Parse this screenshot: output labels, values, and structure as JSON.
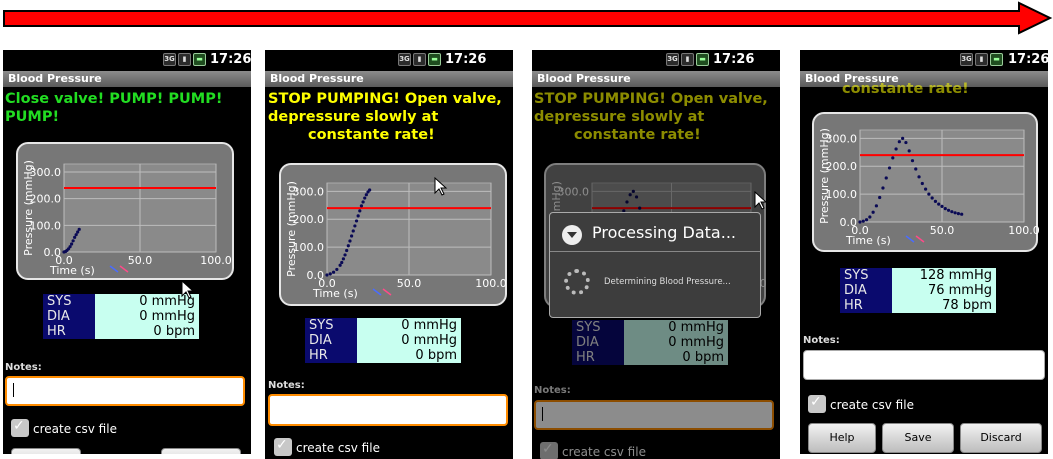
{
  "colors": {
    "instruction_green": "#22dd22",
    "instruction_yellow": "#ffff00",
    "threshold_line": "#ff0000",
    "label_bg": "#0a0a6e",
    "value_bg": "#c8fff0",
    "focus_border": "#ff8c00",
    "arrow": "#ff0000"
  },
  "screens": [
    {
      "status": {
        "time": "17:26"
      },
      "app_title": "Blood Pressure",
      "instruction": "Close valve! PUMP! PUMP! PUMP!",
      "table": [
        {
          "label": "SYS",
          "value": "0 mmHg"
        },
        {
          "label": "DIA",
          "value": "0 mmHg"
        },
        {
          "label": "HR",
          "value": "0 bpm"
        }
      ],
      "notes_label": "Notes:",
      "checkbox_label": "create csv file"
    },
    {
      "status": {
        "time": "17:26"
      },
      "app_title": "Blood Pressure",
      "instruction_l1": "STOP PUMPING! Open valve,",
      "instruction_l2": "depressure slowly at",
      "instruction_l3": "constante rate!",
      "table": [
        {
          "label": "SYS",
          "value": "0 mmHg"
        },
        {
          "label": "DIA",
          "value": "0 mmHg"
        },
        {
          "label": "HR",
          "value": "0 bpm"
        }
      ],
      "notes_label": "Notes:",
      "checkbox_label": "create csv file"
    },
    {
      "status": {
        "time": "17:26"
      },
      "app_title": "Blood Pressure",
      "instruction_l1": "STOP PUMPING! Open valve,",
      "instruction_l2": "depressure slowly at",
      "instruction_l3": "constante rate!",
      "dialog": {
        "title": "Processing Data...",
        "message": "Determining Blood Pressure..."
      },
      "table": [
        {
          "label": "SYS",
          "value": "0 mmHg"
        },
        {
          "label": "DIA",
          "value": "0 mmHg"
        },
        {
          "label": "HR",
          "value": "0 bpm"
        }
      ],
      "notes_label": "Notes:",
      "checkbox_label": "create csv file"
    },
    {
      "status": {
        "time": "17:26"
      },
      "app_title": "Blood Pressure",
      "instruction_partial": "constante rate!",
      "table": [
        {
          "label": "SYS",
          "value": "128 mmHg"
        },
        {
          "label": "DIA",
          "value": "76 mmHg"
        },
        {
          "label": "HR",
          "value": "78 bpm"
        }
      ],
      "notes_label": "Notes:",
      "checkbox_label": "create csv file",
      "buttons": {
        "help": "Help",
        "save": "Save",
        "discard": "Discard"
      }
    }
  ],
  "chart_data": [
    {
      "type": "scatter",
      "ylabel": "Pressure (mmHg)",
      "xlabel": "Time (s)",
      "y_ticks": [
        "0.0",
        "100.0",
        "200.0",
        "300.0"
      ],
      "x_ticks": [
        "0.0",
        "50.0",
        "100.0"
      ],
      "xlim": [
        0,
        100
      ],
      "ylim": [
        0,
        330
      ],
      "threshold": 240,
      "series": [
        {
          "x": [
            0,
            1,
            2,
            3,
            4,
            5,
            6,
            7,
            8,
            9,
            10
          ],
          "y": [
            0,
            2,
            6,
            12,
            20,
            30,
            42,
            55,
            65,
            75,
            85
          ]
        }
      ]
    },
    {
      "type": "scatter",
      "ylabel": "Pressure (mmHg)",
      "xlabel": "Time (s)",
      "y_ticks": [
        "0.0",
        "100.0",
        "200.0",
        "300.0"
      ],
      "x_ticks": [
        "0.0",
        "50.0",
        "100.0"
      ],
      "xlim": [
        0,
        100
      ],
      "ylim": [
        0,
        330
      ],
      "threshold": 240,
      "series": [
        {
          "x": [
            0,
            2,
            4,
            6,
            8,
            9,
            10,
            11,
            12,
            13,
            14,
            15,
            16,
            17,
            18,
            19,
            20,
            21,
            22,
            23,
            24,
            25,
            26
          ],
          "y": [
            0,
            4,
            10,
            20,
            35,
            45,
            58,
            72,
            88,
            105,
            122,
            140,
            158,
            176,
            194,
            212,
            230,
            248,
            262,
            276,
            288,
            298,
            305
          ]
        }
      ]
    },
    {
      "type": "scatter",
      "ylabel": "Pressure (mmHg)",
      "xlabel": "Time (s)",
      "y_ticks": [
        "0.0",
        "100.0",
        "200.0",
        "300.0"
      ],
      "x_ticks": [
        "0.0",
        "50.0",
        "100.0"
      ],
      "xlim": [
        0,
        100
      ],
      "ylim": [
        0,
        330
      ],
      "threshold": 240,
      "series": [
        {
          "x": [
            0,
            4,
            8,
            10,
            12,
            14,
            16,
            18,
            20,
            22,
            24,
            26,
            28,
            30,
            33,
            36,
            40,
            44,
            48,
            52,
            56,
            60
          ],
          "y": [
            0,
            10,
            35,
            58,
            88,
            122,
            158,
            194,
            230,
            262,
            288,
            300,
            280,
            240,
            200,
            160,
            120,
            90,
            65,
            45,
            32,
            25
          ]
        }
      ]
    },
    {
      "type": "scatter",
      "ylabel": "Pressure (mmHg)",
      "xlabel": "Time (s)",
      "y_ticks": [
        "0.0",
        "100.0",
        "200.0",
        "300.0"
      ],
      "x_ticks": [
        "0.0",
        "50.0",
        "100.0"
      ],
      "xlim": [
        0,
        100
      ],
      "ylim": [
        0,
        330
      ],
      "threshold": 240,
      "series": [
        {
          "x": [
            0,
            2,
            4,
            6,
            8,
            10,
            12,
            14,
            16,
            18,
            20,
            22,
            24,
            26,
            28,
            30,
            32,
            34,
            36,
            38,
            40,
            42,
            44,
            46,
            48,
            50,
            52,
            54,
            56,
            58,
            60,
            62
          ],
          "y": [
            0,
            3,
            8,
            18,
            35,
            58,
            88,
            122,
            158,
            194,
            230,
            262,
            288,
            300,
            285,
            255,
            220,
            190,
            162,
            138,
            118,
            100,
            86,
            74,
            64,
            56,
            48,
            42,
            37,
            33,
            30,
            28
          ]
        }
      ]
    }
  ]
}
